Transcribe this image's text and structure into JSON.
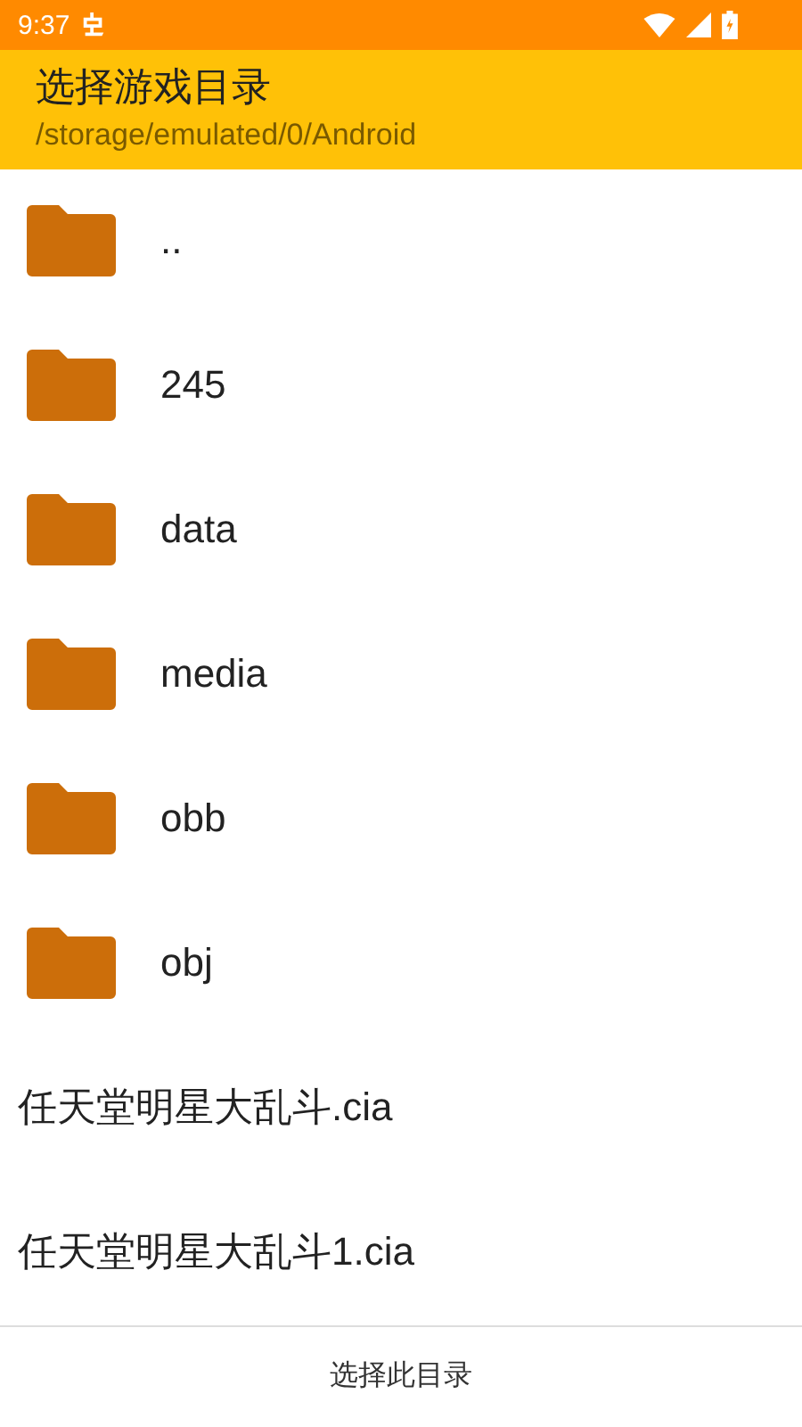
{
  "status_bar": {
    "time": "9:37"
  },
  "header": {
    "title": "选择游戏目录",
    "path": "/storage/emulated/0/Android"
  },
  "items": [
    {
      "kind": "folder",
      "name": ".."
    },
    {
      "kind": "folder",
      "name": "245"
    },
    {
      "kind": "folder",
      "name": "data"
    },
    {
      "kind": "folder",
      "name": "media"
    },
    {
      "kind": "folder",
      "name": "obb"
    },
    {
      "kind": "folder",
      "name": "obj"
    },
    {
      "kind": "file",
      "name": "任天堂明星大乱斗.cia"
    },
    {
      "kind": "file",
      "name": "任天堂明星大乱斗1.cia"
    }
  ],
  "footer": {
    "button": "选择此目录"
  }
}
